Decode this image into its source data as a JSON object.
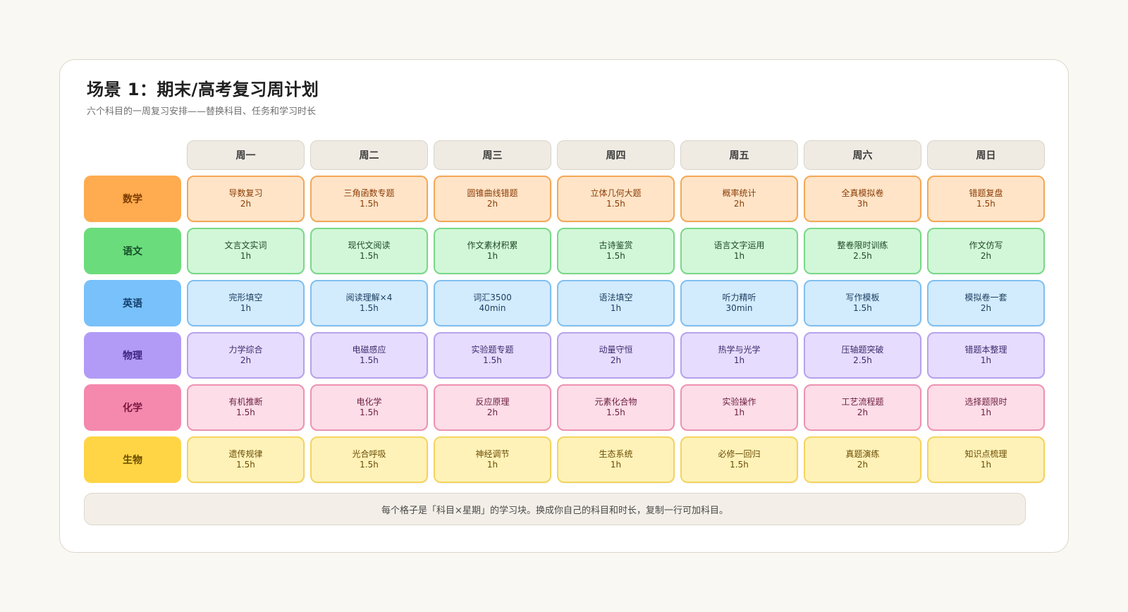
{
  "header": {
    "title": "场景 1：期末/高考复习周计划",
    "subtitle": "六个科目的一周复习安排——替换科目、任务和学习时长"
  },
  "days": [
    "周一",
    "周二",
    "周三",
    "周四",
    "周五",
    "周六",
    "周日"
  ],
  "subjects": [
    {
      "name": "数学",
      "colors": {
        "label_bg": "#ffab4f",
        "label_text": "#7a3a00",
        "cell_bg": "#ffe4c8",
        "cell_border": "#f3a857",
        "cell_text": "#8a3d06"
      },
      "tasks": [
        {
          "task": "导数复习",
          "duration": "2h"
        },
        {
          "task": "三角函数专题",
          "duration": "1.5h"
        },
        {
          "task": "圆锥曲线错题",
          "duration": "2h"
        },
        {
          "task": "立体几何大题",
          "duration": "1.5h"
        },
        {
          "task": "概率统计",
          "duration": "2h"
        },
        {
          "task": "全真模拟卷",
          "duration": "3h"
        },
        {
          "task": "错题复盘",
          "duration": "1.5h"
        }
      ]
    },
    {
      "name": "语文",
      "colors": {
        "label_bg": "#6bdc7c",
        "label_text": "#15502a",
        "cell_bg": "#d2f7d8",
        "cell_border": "#79d889",
        "cell_text": "#1e4a26"
      },
      "tasks": [
        {
          "task": "文言文实词",
          "duration": "1h"
        },
        {
          "task": "现代文阅读",
          "duration": "1.5h"
        },
        {
          "task": "作文素材积累",
          "duration": "1h"
        },
        {
          "task": "古诗鉴赏",
          "duration": "1.5h"
        },
        {
          "task": "语言文字运用",
          "duration": "1h"
        },
        {
          "task": "整卷限时训练",
          "duration": "2.5h"
        },
        {
          "task": "作文仿写",
          "duration": "2h"
        }
      ]
    },
    {
      "name": "英语",
      "colors": {
        "label_bg": "#79c1fa",
        "label_text": "#123f6b",
        "cell_bg": "#d2ebfd",
        "cell_border": "#80bff0",
        "cell_text": "#1b3d5e"
      },
      "tasks": [
        {
          "task": "完形填空",
          "duration": "1h"
        },
        {
          "task": "阅读理解×4",
          "duration": "1.5h"
        },
        {
          "task": "词汇3500",
          "duration": "40min"
        },
        {
          "task": "语法填空",
          "duration": "1h"
        },
        {
          "task": "听力精听",
          "duration": "30min"
        },
        {
          "task": "写作模板",
          "duration": "1.5h"
        },
        {
          "task": "模拟卷一套",
          "duration": "2h"
        }
      ]
    },
    {
      "name": "物理",
      "colors": {
        "label_bg": "#b29bf7",
        "label_text": "#3e2380",
        "cell_bg": "#e6dcfd",
        "cell_border": "#b7a1ef",
        "cell_text": "#3e2c6e"
      },
      "tasks": [
        {
          "task": "力学综合",
          "duration": "2h"
        },
        {
          "task": "电磁感应",
          "duration": "1.5h"
        },
        {
          "task": "实验题专题",
          "duration": "1.5h"
        },
        {
          "task": "动量守恒",
          "duration": "2h"
        },
        {
          "task": "热学与光学",
          "duration": "1h"
        },
        {
          "task": "压轴题突破",
          "duration": "2.5h"
        },
        {
          "task": "错题本整理",
          "duration": "1h"
        }
      ]
    },
    {
      "name": "化学",
      "colors": {
        "label_bg": "#f588ad",
        "label_text": "#7a1840",
        "cell_bg": "#fcdde8",
        "cell_border": "#ee92b2",
        "cell_text": "#6e2040"
      },
      "tasks": [
        {
          "task": "有机推断",
          "duration": "1.5h"
        },
        {
          "task": "电化学",
          "duration": "1.5h"
        },
        {
          "task": "反应原理",
          "duration": "2h"
        },
        {
          "task": "元素化合物",
          "duration": "1.5h"
        },
        {
          "task": "实验操作",
          "duration": "1h"
        },
        {
          "task": "工艺流程题",
          "duration": "2h"
        },
        {
          "task": "选择题限时",
          "duration": "1h"
        }
      ]
    },
    {
      "name": "生物",
      "colors": {
        "label_bg": "#ffd545",
        "label_text": "#6a4a00",
        "cell_bg": "#fff2b8",
        "cell_border": "#f4d45e",
        "cell_text": "#6b4d05"
      },
      "tasks": [
        {
          "task": "遗传规律",
          "duration": "1.5h"
        },
        {
          "task": "光合呼吸",
          "duration": "1.5h"
        },
        {
          "task": "神经调节",
          "duration": "1h"
        },
        {
          "task": "生态系统",
          "duration": "1h"
        },
        {
          "task": "必修一回归",
          "duration": "1.5h"
        },
        {
          "task": "真题演练",
          "duration": "2h"
        },
        {
          "task": "知识点梳理",
          "duration": "1h"
        }
      ]
    }
  ],
  "footer": {
    "note": "每个格子是「科目×星期」的学习块。换成你自己的科目和时长，复制一行可加科目。"
  }
}
